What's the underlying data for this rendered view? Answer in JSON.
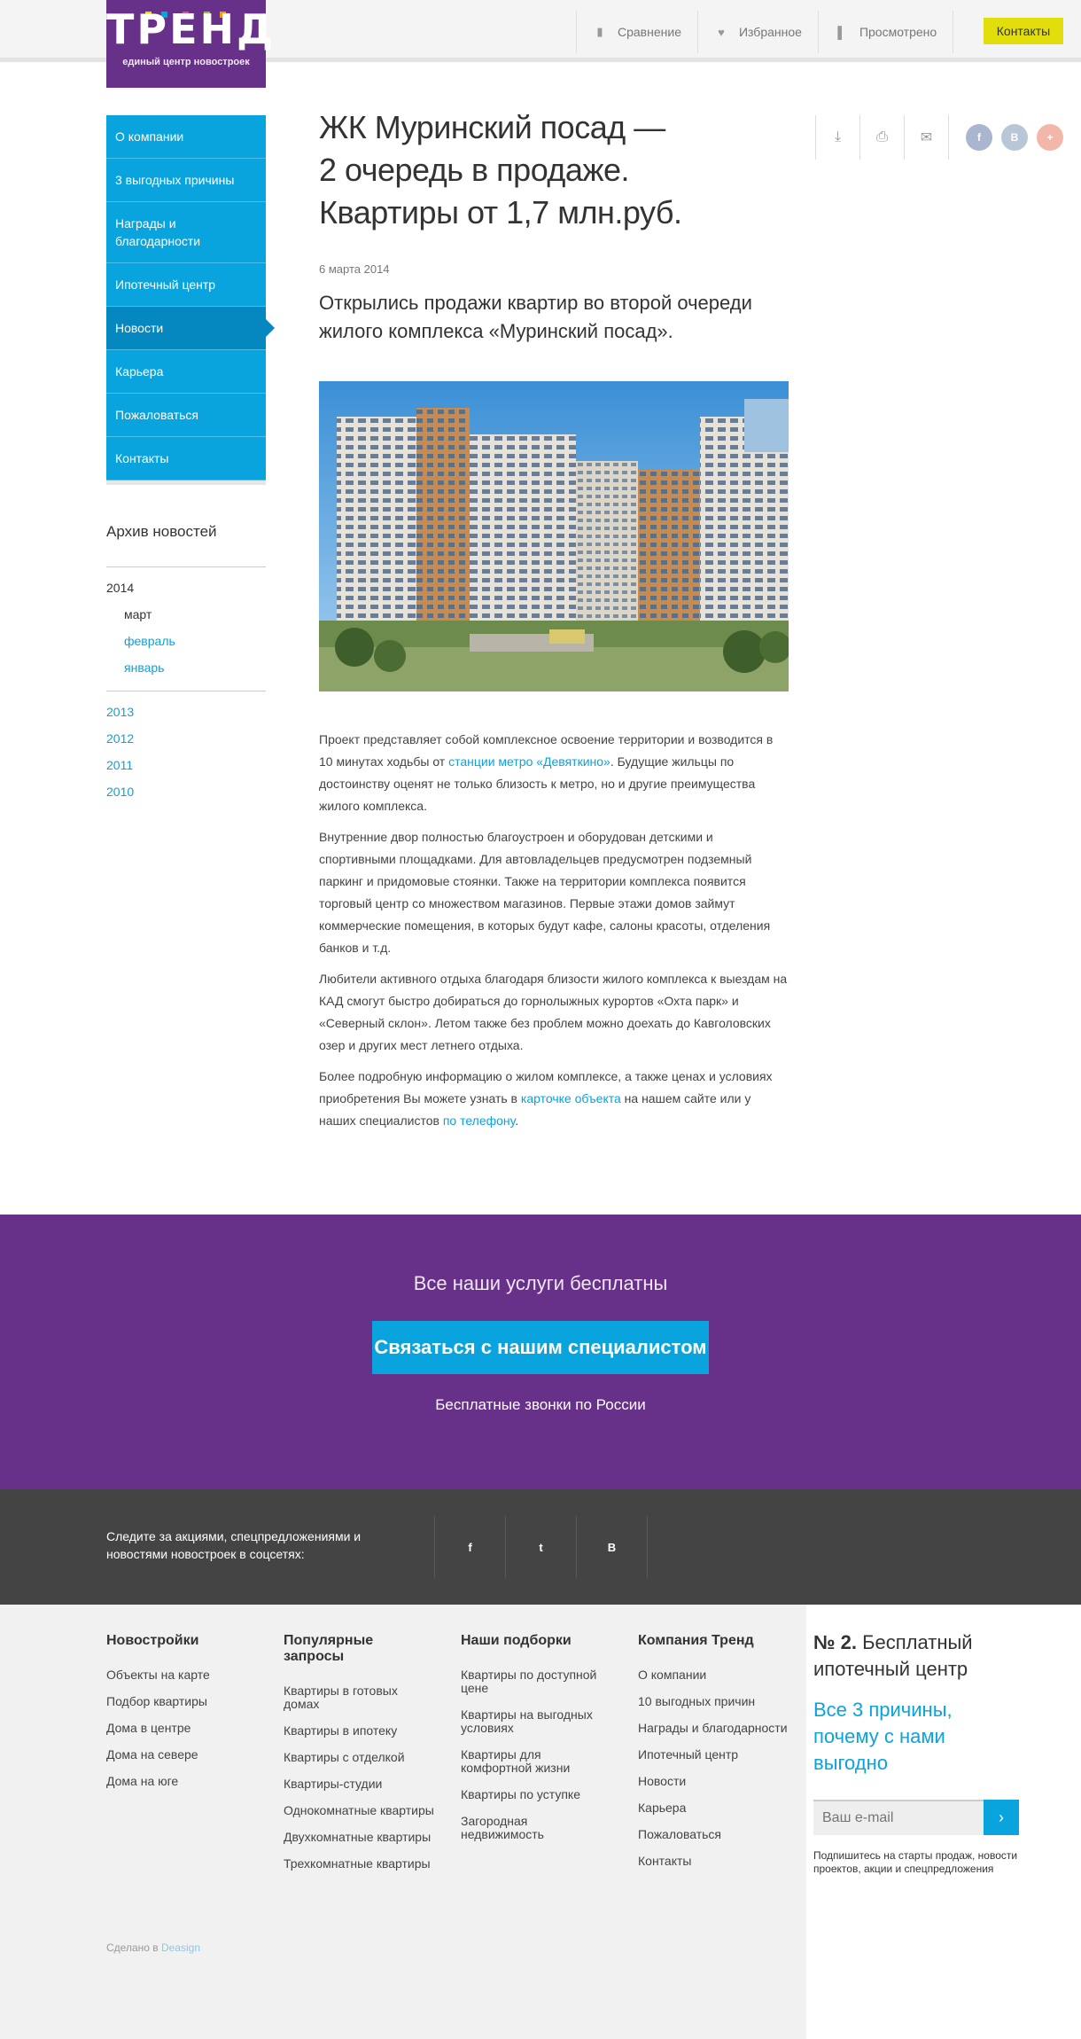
{
  "header": {
    "logo_word": "ТРЕНД",
    "logo_tagline": "единый центр новостроек",
    "nav": [
      {
        "label": "Сравнение",
        "icon": "bar-chart-icon"
      },
      {
        "label": "Избранное",
        "icon": "heart-icon"
      },
      {
        "label": "Просмотрено",
        "icon": "bookmark-icon"
      }
    ],
    "contacts_button": "Контакты"
  },
  "sidebar": {
    "items": [
      {
        "label": "О компании"
      },
      {
        "label": "3 выгодных причины"
      },
      {
        "label": "Награды и благодарности"
      },
      {
        "label": "Ипотечный центр"
      },
      {
        "label": "Новости",
        "active": true
      },
      {
        "label": "Карьера"
      },
      {
        "label": "Пожаловаться"
      },
      {
        "label": "Контакты"
      }
    ],
    "archive_title": "Архив новостей",
    "archive_current_year": "2014",
    "archive_months": [
      "март",
      "февраль",
      "январь"
    ],
    "archive_years": [
      "2013",
      "2012",
      "2011",
      "2010"
    ]
  },
  "article": {
    "title_lines": [
      "ЖК Муринский посад —",
      "2 очередь в продаже.",
      "Квартиры от 1,7 млн.руб."
    ],
    "date": "6 марта 2014",
    "lead": "Открылись продажи квартир во второй очереди жилого комплекса «Муринский посад».",
    "p1_a": "Проект представляет  собой комплексное освоение территории и возводится в 10 минутах ходьбы от ",
    "p1_link": "станции метро «Девяткино»",
    "p1_b": ". Будущие жильцы по достоинству оценят не только близость к метро, но и другие преимущества жилого комплекса.",
    "p2": "Внутренние двор полностью благоустроен и оборудован детскими и спортивными площадками. Для автовладельцев предусмотрен подземный паркинг и придомовые стоянки. Также на территории комплекса появится торговый центр со множеством магазинов. Первые этажи домов займут коммерческие помещения, в которых будут кафе, салоны красоты, отделения банков и т.д.",
    "p3": "Любители активного отдыха благодаря близости жилого комплекса к выездам на КАД смогут быстро добираться до горнолыжных курортов «Охта парк» и «Северный склон». Летом также без проблем можно доехать до Кавголовских озер и других мест летнего отдыха.",
    "p4_a": "Более подробную информацию о жилом комплексе, а также ценах и условиях приобретения Вы можете узнать в ",
    "p4_link1": "карточке объекта",
    "p4_b": " на нашем сайте или у наших специалистов ",
    "p4_link2": "по телефону",
    "p4_c": "."
  },
  "share": {
    "tools": [
      "pdf-icon",
      "print-icon",
      "mail-icon"
    ],
    "social": [
      {
        "label": "f",
        "color": "#aab6cf"
      },
      {
        "label": "В",
        "color": "#b9c6d8"
      },
      {
        "label": "+",
        "color": "#f3b7a9"
      }
    ]
  },
  "promo": {
    "heading": "Все наши услуги бесплатны",
    "button": "Связаться с нашим специалистом",
    "subtext": "Бесплатные звонки по России"
  },
  "social_band": {
    "text": "Следите за акциями, спецпредложениями и новостями новостроек в соцсетях:",
    "icons": [
      "f",
      "t",
      "В"
    ]
  },
  "footer": {
    "columns": [
      {
        "title": "Новостройки",
        "links": [
          "Объекты на карте",
          "Подбор квартиры",
          "Дома в центре",
          "Дома на севере",
          "Дома на юге"
        ]
      },
      {
        "title": "Популярные запросы",
        "links": [
          "Квартиры в готовых домах",
          "Квартиры в ипотеку",
          "Квартиры с отделкой",
          "Квартиры-студии",
          "Однокомнатные квартиры",
          "Двухкомнатные квартиры",
          "Трехкомнатные квартиры"
        ]
      },
      {
        "title": "Наши подборки",
        "links": [
          "Квартиры по доступной цене",
          "Квартиры на выгодных условиях",
          "Квартиры для комфортной жизни",
          "Квартиры по уступке",
          "Загородная недвижимость"
        ]
      },
      {
        "title": "Компания Тренд",
        "links": [
          "О компании",
          "10 выгодных причин",
          "Награды и благодарности",
          "Ипотечный центр",
          "Новости",
          "Карьера",
          "Пожаловаться",
          "Контакты"
        ]
      }
    ],
    "made_prefix": "Сделано в ",
    "made_link": "Deasign"
  },
  "mortgage": {
    "number": "№ 2.",
    "title_rest": " Бесплатный ипотечный центр",
    "link": "Все 3 причины, почему с нами выгодно",
    "email_placeholder": "Ваш e-mail",
    "note": "Подпишитесь на старты продаж, новости проектов, акции и спецпредложения"
  }
}
